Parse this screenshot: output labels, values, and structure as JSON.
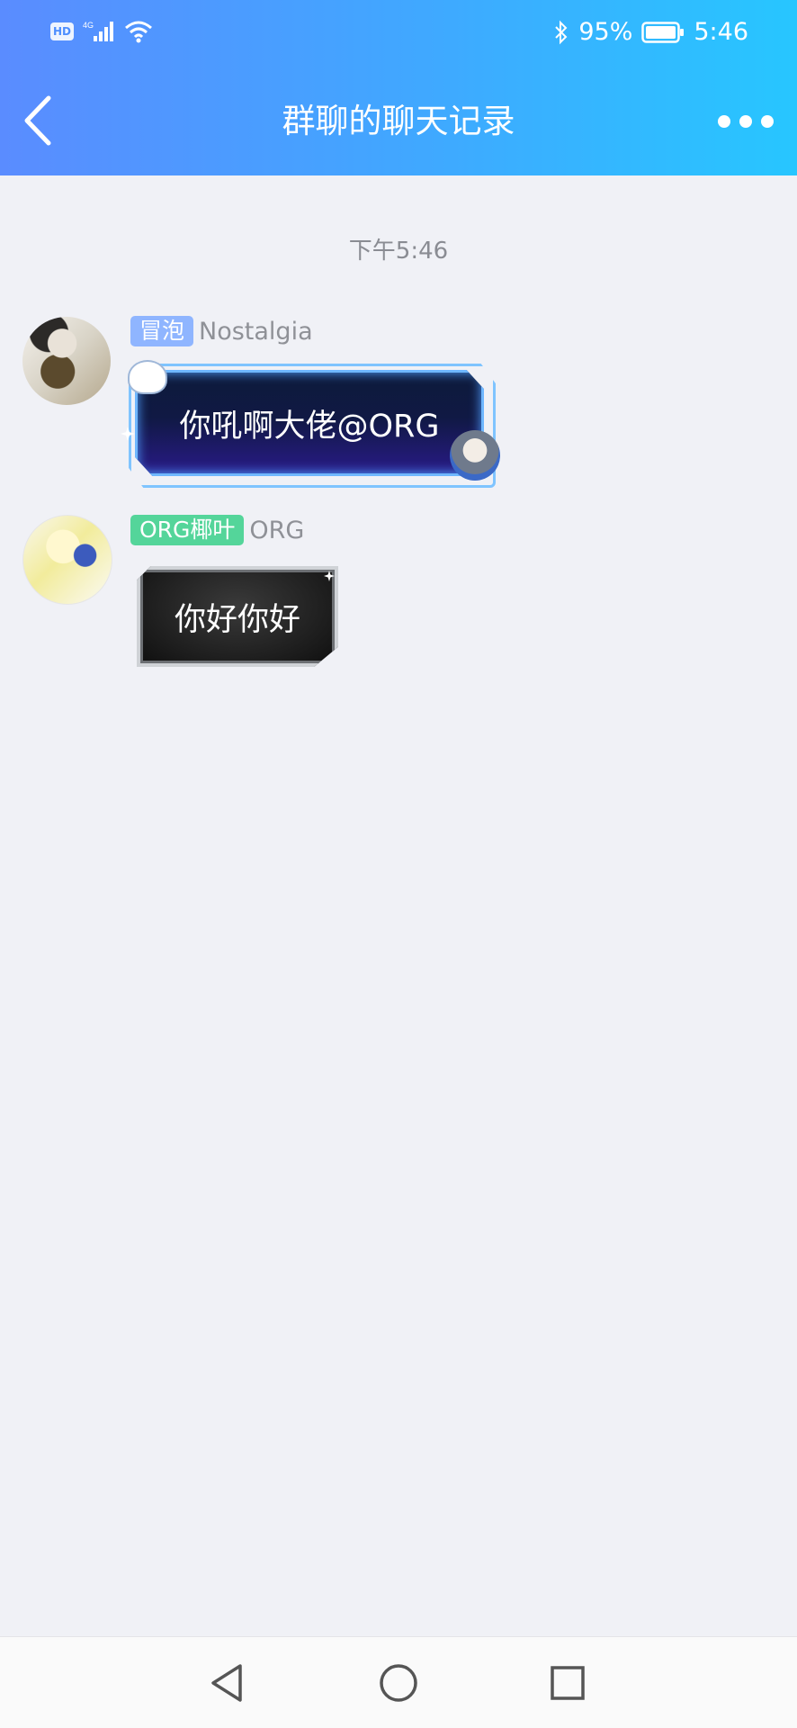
{
  "status_bar": {
    "hd": "HD",
    "network": "4G",
    "battery": "95%",
    "time": "5:46"
  },
  "header": {
    "title": "群聊的聊天记录",
    "back_icon": "chevron-left-icon",
    "more_icon": "more-dots-icon"
  },
  "chat": {
    "timestamp": "下午5:46",
    "messages": [
      {
        "tag": "冒泡",
        "tag_color": "#8fb5ff",
        "nickname": "Nostalgia",
        "text": "你吼啊大佬@ORG"
      },
      {
        "tag": "ORG椰叶",
        "tag_color": "#54d59a",
        "nickname": "ORG",
        "text": "你好你好"
      }
    ]
  },
  "colors": {
    "header_gradient_start": "#5a8cff",
    "header_gradient_end": "#27c6ff",
    "background": "#f0f1f6"
  },
  "bottom_nav": {
    "back_icon": "triangle-back-icon",
    "home_icon": "circle-home-icon",
    "recents_icon": "square-recents-icon"
  }
}
